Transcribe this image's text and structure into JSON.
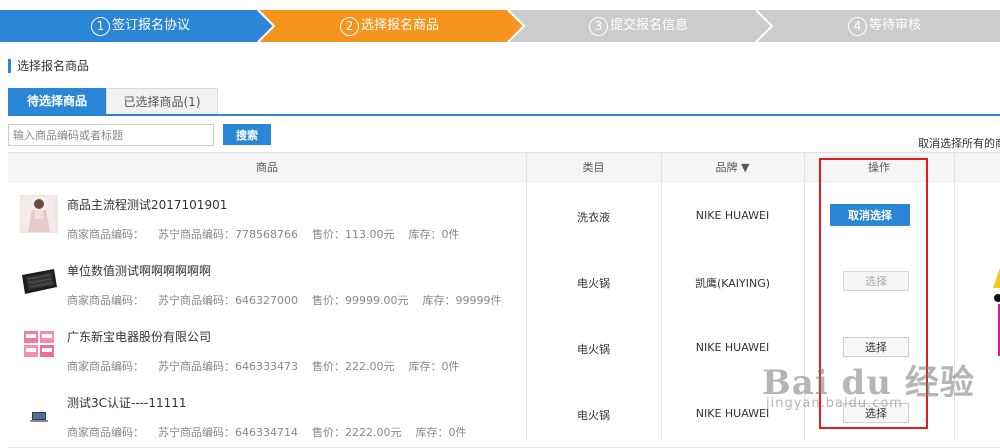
{
  "steps": [
    {
      "num": "1",
      "label": "签订报名协议",
      "color": "#2b86d8"
    },
    {
      "num": "2",
      "label": "选择报名商品",
      "color": "#f7941d"
    },
    {
      "num": "3",
      "label": "提交报名信息",
      "color": "#cccccc"
    },
    {
      "num": "4",
      "label": "等待审核",
      "color": "#cccccc"
    }
  ],
  "section_title": "选择报名商品",
  "tabs": {
    "pending": "待选择商品",
    "selected": "已选择商品(1)"
  },
  "search": {
    "placeholder": "输入商品编码或者标题",
    "button": "搜索"
  },
  "cancel_all": "取消选择所有的商品",
  "columns": {
    "product": "商品",
    "category": "类目",
    "brand": "品牌 ▼",
    "action": "操作"
  },
  "meta_labels": {
    "merchant_code": "商家商品编码：",
    "suning_code": "苏宁商品编码：",
    "price": "售价：",
    "stock": "库存："
  },
  "rows": [
    {
      "title": "商品主流程测试2017101901",
      "suning_code": "778568766",
      "price": "113.00元",
      "stock": "0件",
      "category": "洗衣液",
      "brand": "NIKE HUAWEI",
      "action": "取消选择",
      "action_state": "primary",
      "thumb_icon": "dress-photo-icon"
    },
    {
      "title": "单位数值测试啊啊啊啊啊啊",
      "suning_code": "646327000",
      "price": "99999.00元",
      "stock": "99999件",
      "category": "电火锅",
      "brand": "凯鹰(KAIYING)",
      "action": "选择",
      "action_state": "disabled",
      "thumb_icon": "wallet-photo-icon"
    },
    {
      "title": "广东新宝电器股份有限公司",
      "suning_code": "646333473",
      "price": "222.00元",
      "stock": "0件",
      "category": "电火锅",
      "brand": "NIKE HUAWEI",
      "action": "选择",
      "action_state": "default",
      "thumb_icon": "tissue-photo-icon"
    },
    {
      "title": "测试3C认证----11111",
      "suning_code": "646334714",
      "price": "2222.00元",
      "stock": "0件",
      "category": "电火锅",
      "brand": "NIKE HUAWEI",
      "action": "选择",
      "action_state": "default",
      "thumb_icon": "laptop-photo-icon"
    }
  ],
  "watermark": {
    "main": "Bai du 经验",
    "sub": "jingyan.baidu.com"
  },
  "colors": {
    "accent": "#2b86d8",
    "highlight": "#e02020"
  }
}
